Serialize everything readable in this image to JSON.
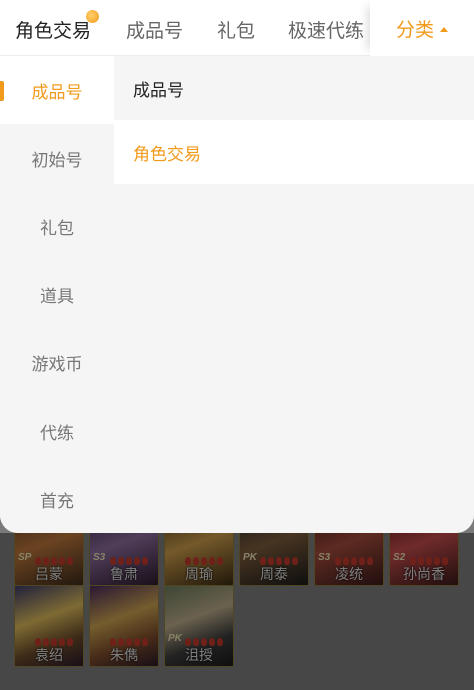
{
  "top_tabs": [
    "角色交易",
    "成品号",
    "礼包",
    "极速代练"
  ],
  "category_button": "分类",
  "left_menu": [
    "成品号",
    "初始号",
    "礼包",
    "道具",
    "游戏币",
    "代练",
    "首充"
  ],
  "sub_menu": [
    "成品号",
    "角色交易"
  ],
  "heroes": [
    {
      "name": "吕蒙",
      "tag": "SP"
    },
    {
      "name": "鲁肃",
      "tag": "S3"
    },
    {
      "name": "周瑜",
      "tag": ""
    },
    {
      "name": "周泰",
      "tag": "PK"
    },
    {
      "name": "凌统",
      "tag": "S3"
    },
    {
      "name": "孙尚香",
      "tag": "S2"
    },
    {
      "name": "袁绍",
      "tag": ""
    },
    {
      "name": "朱儁",
      "tag": ""
    },
    {
      "name": "沮授",
      "tag": "PK"
    }
  ],
  "colors": {
    "accent": "#f29a1c",
    "panel_bg": "#f5f5f5"
  }
}
